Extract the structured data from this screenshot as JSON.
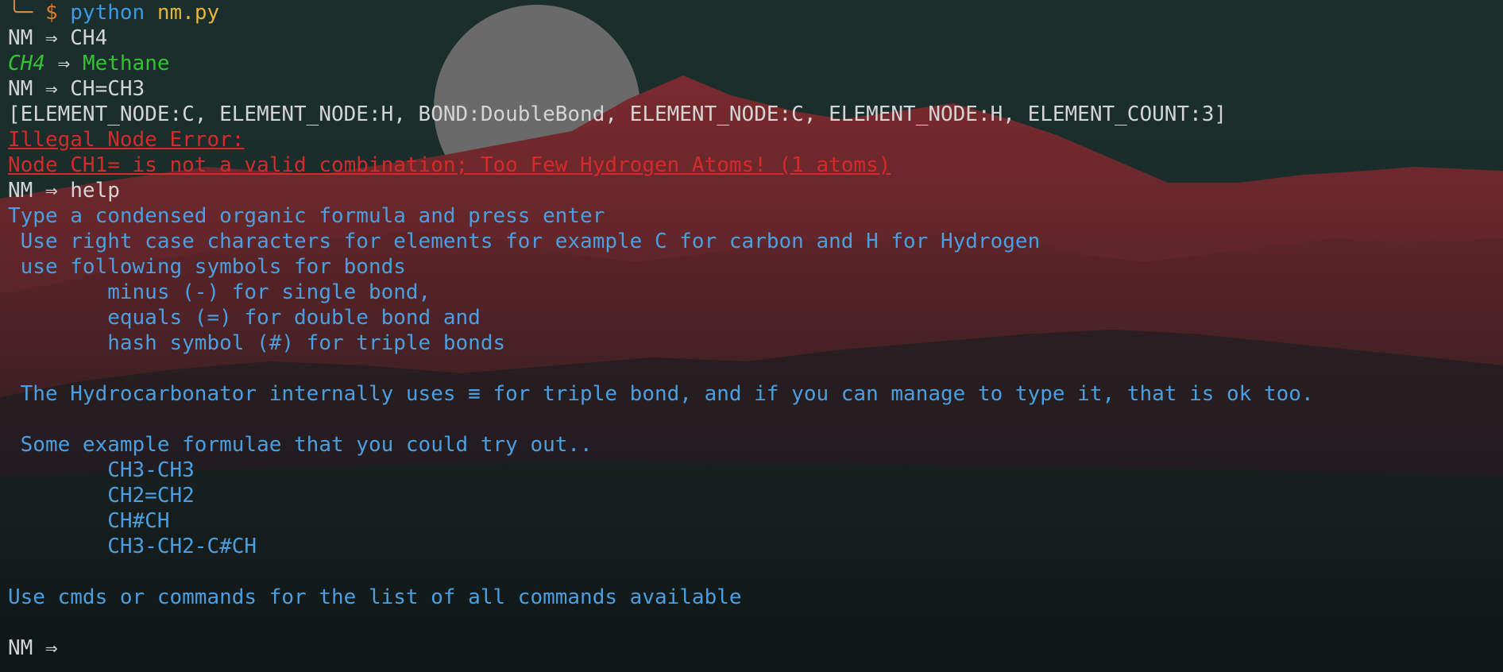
{
  "terminal": {
    "prompt_label": "NM",
    "prompt_arrow": "⇒",
    "lines": {
      "l0": {
        "corner": "╰─",
        "dollar": "$",
        "cmd": "python",
        "file": "nm.py"
      },
      "l1": {
        "input": "CH4"
      },
      "l2": {
        "formula": "CH4",
        "name": "Methane"
      },
      "l3": {
        "input": "CH=CH3"
      },
      "l4": {
        "text": "[ELEMENT_NODE:C, ELEMENT_NODE:H, BOND:DoubleBond, ELEMENT_NODE:C, ELEMENT_NODE:H, ELEMENT_COUNT:3]"
      },
      "l5": {
        "text": "Illegal Node Error:"
      },
      "l6": {
        "text": "Node CH1= is not a valid combination; Too Few Hydrogen Atoms! (1 atoms)"
      },
      "l7": {
        "input": "help"
      },
      "l8": {
        "text": "Type a condensed organic formula and press enter"
      },
      "l9": {
        "text": " Use right case characters for elements for example C for carbon and H for Hydrogen"
      },
      "l10": {
        "text": " use following symbols for bonds"
      },
      "l11": {
        "text": "        minus (-) for single bond,"
      },
      "l12": {
        "text": "        equals (=) for double bond and"
      },
      "l13": {
        "text": "        hash symbol (#) for triple bonds"
      },
      "l14": {
        "text": ""
      },
      "l15": {
        "text": " The Hydrocarbonator internally uses ≡ for triple bond, and if you can manage to type it, that is ok too."
      },
      "l16": {
        "text": ""
      },
      "l17": {
        "text": " Some example formulae that you could try out.."
      },
      "l18": {
        "text": "        CH3-CH3"
      },
      "l19": {
        "text": "        CH2=CH2"
      },
      "l20": {
        "text": "        CH#CH"
      },
      "l21": {
        "text": "        CH3-CH2-C#CH"
      },
      "l22": {
        "text": ""
      },
      "l23": {
        "text": "Use cmds or commands for the list of all commands available"
      },
      "l24": {
        "text": ""
      },
      "l25": {
        "input": ""
      }
    }
  },
  "colors": {
    "prompt": "#d4d4d4",
    "error": "#d42a2a",
    "info": "#4b9fe0",
    "success": "#34c234",
    "python_keyword": "#3a9ae8",
    "filename": "#e5b43a",
    "dollar": "#e07b2c"
  },
  "background": {
    "icon": "mountain-landscape-wallpaper",
    "moon_color": "#6a6a6a",
    "mountain_color": "#7a2a2e"
  }
}
